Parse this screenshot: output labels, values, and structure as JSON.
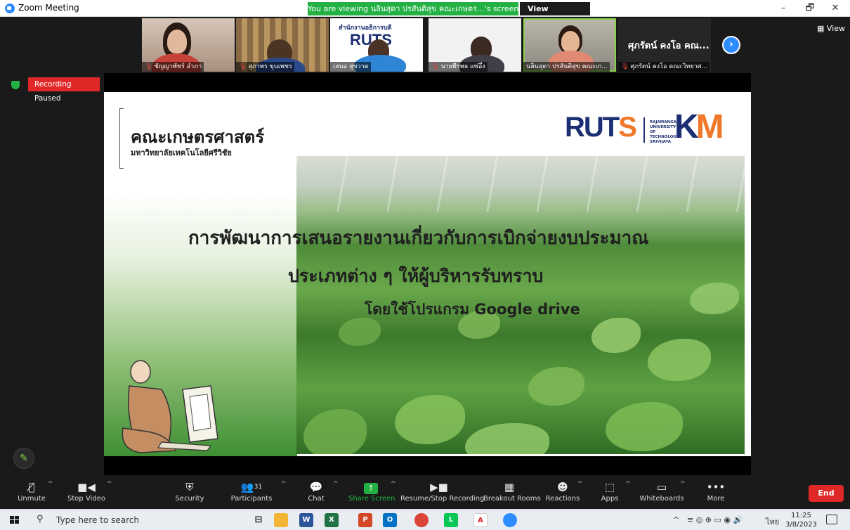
{
  "window": {
    "title": "Zoom Meeting",
    "viewing_banner": "You are viewing นลินสุดา ปรสันติสุข คณะเกษตร...'s screen",
    "view_options": "View Options",
    "controls": [
      "–",
      "🗗",
      "✕"
    ]
  },
  "participants_strip": {
    "tiles": [
      {
        "name": "ชัญญาพัชร์ อำภา",
        "muted": true
      },
      {
        "name": "สุภาพร ขุนเพชร",
        "muted": true
      },
      {
        "name": "เสนอ สุขวาด",
        "muted": false
      },
      {
        "name": "นายพีรพล แซ่อึ๋ง",
        "muted": true
      },
      {
        "name": "นลินสุดา ปรสันติสุข คณะเก...",
        "muted": false,
        "active": true
      },
      {
        "name": "ศุภรัตน์ คงโอ คณะวิทยาศ...",
        "muted": true,
        "big_label": "ศุภรัตน์ คงโอ คณ..."
      }
    ],
    "next_icon": "chevron-right-icon",
    "view_label": "View",
    "tile_logo_text": "สำนักงานอธิการบดี",
    "tile_logo_ruts": "RUTS"
  },
  "recording": {
    "label": "Recording Paused"
  },
  "slide": {
    "faculty_title": "คณะเกษตรศาสตร์",
    "faculty_subtitle": "มหาวิทยาลัยเทคโนโลยีศรีวิชัย",
    "logo_ruts": "RUT",
    "logo_ruts_s": "S",
    "logo_uni": "RAJAMANGALA UNIVERSITY OF TECHNOLOGY SRIVIJAYA",
    "logo_k": "K",
    "logo_m": "M",
    "line1": "การพัฒนาการเสนอรายงานเกี่ยวกับการเบิกจ่ายงบประมาณ",
    "line2": "ประเภทต่าง ๆ ให้ผู้บริหารรับทราบ",
    "line3": "โดยใช้โปรแกรม Google drive"
  },
  "toolbar": {
    "unmute": "Unmute",
    "stop_video": "Stop Video",
    "security": "Security",
    "participants": "Participants",
    "participants_count": "31",
    "chat": "Chat",
    "share_screen": "Share Screen",
    "recording": "Resume/Stop Recording",
    "breakout": "Breakout Rooms",
    "reactions": "Reactions",
    "apps": "Apps",
    "whiteboards": "Whiteboards",
    "more": "More",
    "end": "End"
  },
  "taskbar": {
    "search_placeholder": "Type here to search",
    "lang": "ไทย",
    "time": "11:25",
    "date": "3/8/2023",
    "apps": [
      "task-view-icon",
      "file-explorer-icon",
      "word-icon",
      "excel-icon",
      "powerpoint-icon",
      "outlook-icon",
      "chrome-icon",
      "line-icon",
      "acrobat-icon",
      "zoom-icon"
    ]
  },
  "colors": {
    "zoom_blue": "#2d8cff",
    "banner_green": "#23b144",
    "end_red": "#e02828",
    "ruts_navy": "#1d2f73",
    "ruts_orange": "#f0782a"
  }
}
